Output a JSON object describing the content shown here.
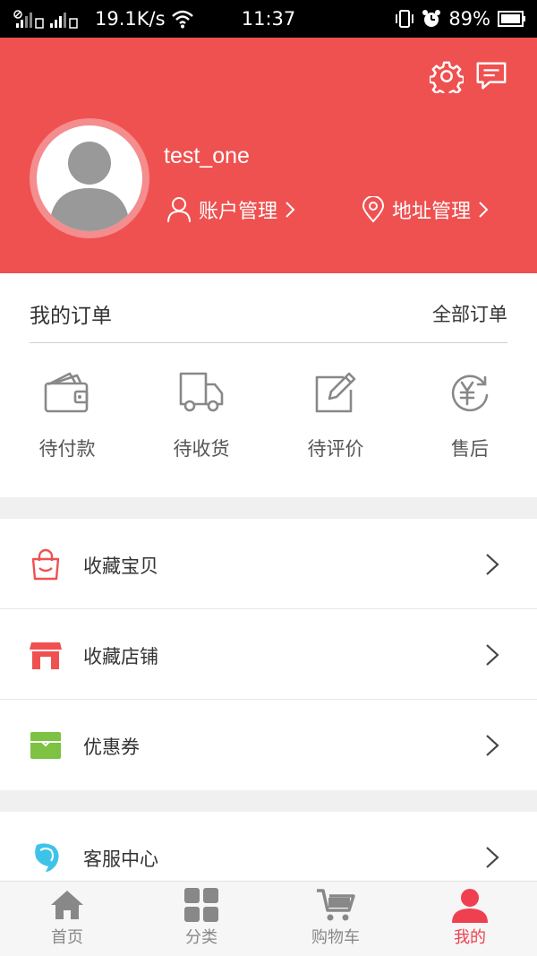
{
  "status_bar": {
    "network_speed": "19.1K/s",
    "time": "11:37",
    "battery": "89%"
  },
  "profile": {
    "username": "test_one",
    "account_link": "账户管理",
    "address_link": "地址管理"
  },
  "orders": {
    "title": "我的订单",
    "all_label": "全部订单",
    "items": [
      {
        "label": "待付款",
        "icon": "wallet-icon"
      },
      {
        "label": "待收货",
        "icon": "truck-icon"
      },
      {
        "label": "待评价",
        "icon": "edit-icon"
      },
      {
        "label": "售后",
        "icon": "yen-refresh-icon"
      }
    ]
  },
  "menu_group_1": [
    {
      "label": "收藏宝贝",
      "icon": "shopping-bag-icon",
      "color": "#ef5150"
    },
    {
      "label": "收藏店铺",
      "icon": "store-icon",
      "color": "#ef5150"
    },
    {
      "label": "优惠券",
      "icon": "coupon-icon",
      "color": "#7dc242"
    }
  ],
  "menu_group_2": [
    {
      "label": "客服中心",
      "icon": "customer-service-icon",
      "color": "#3ec3e8"
    }
  ],
  "tabs": [
    {
      "label": "首页",
      "icon": "home-icon",
      "active": false
    },
    {
      "label": "分类",
      "icon": "category-icon",
      "active": false
    },
    {
      "label": "购物车",
      "icon": "cart-icon",
      "active": false
    },
    {
      "label": "我的",
      "icon": "user-icon",
      "active": true
    }
  ],
  "colors": {
    "brand_red": "#ef5150",
    "tab_active": "#ef4050",
    "icon_gray": "#888888"
  }
}
